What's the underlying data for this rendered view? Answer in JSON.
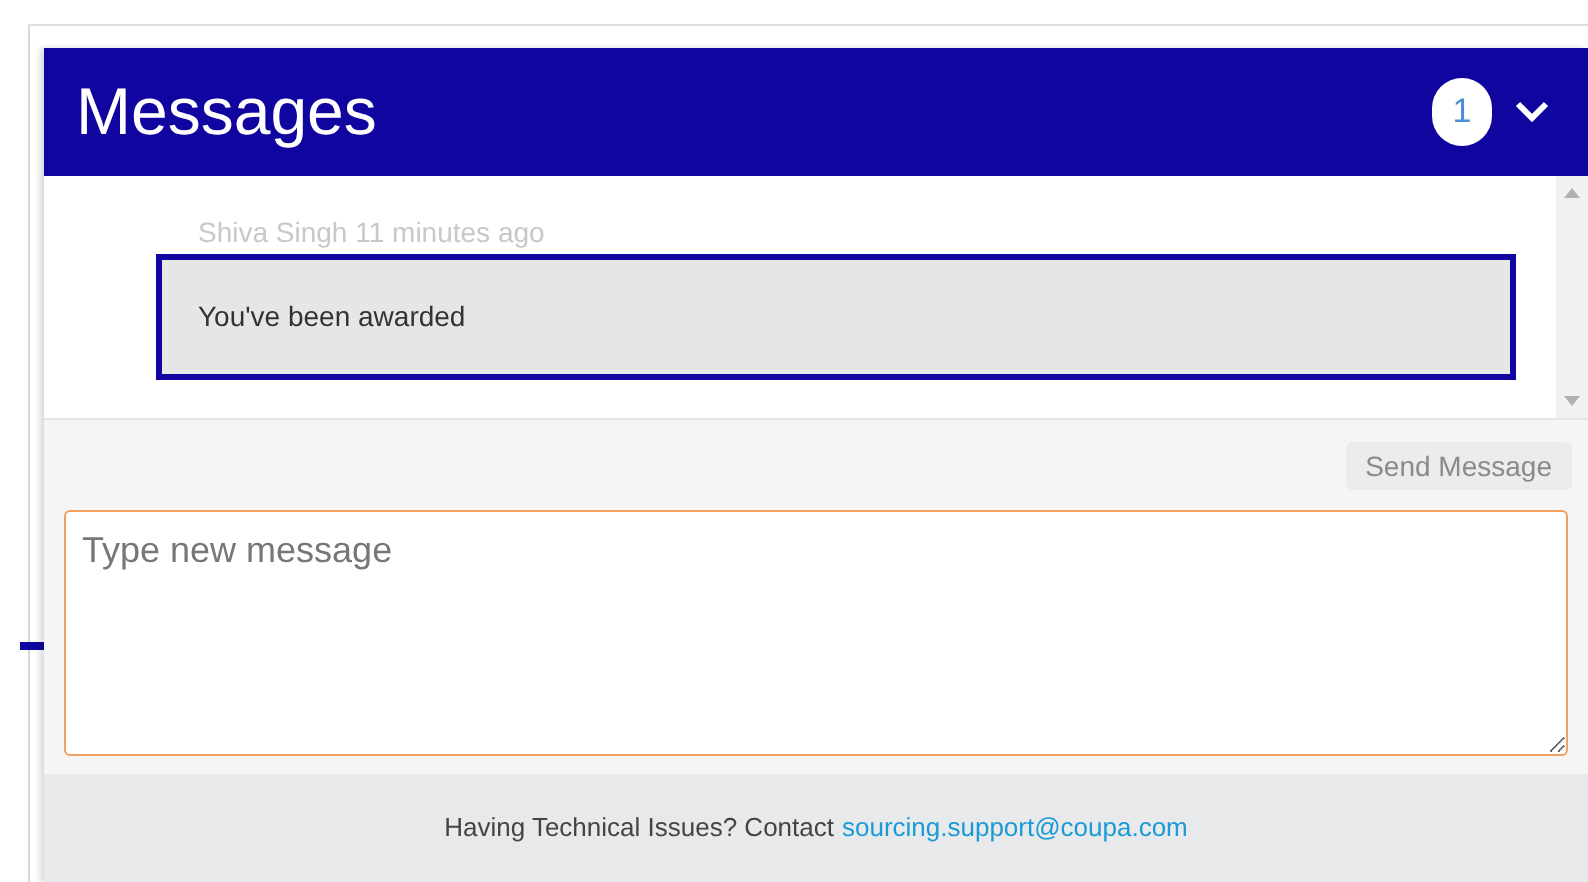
{
  "panel": {
    "title": "Messages",
    "unread_count": "1",
    "expanded": true
  },
  "messages": [
    {
      "meta": "Shiva Singh 11 minutes ago",
      "text": "You've been awarded",
      "highlighted": true
    }
  ],
  "send_button": {
    "label": "Send Message",
    "disabled": true
  },
  "composer": {
    "placeholder": "Type new message"
  },
  "footer": {
    "text": "Having Technical Issues? Contact",
    "link": "sourcing.support@coupa.com"
  }
}
